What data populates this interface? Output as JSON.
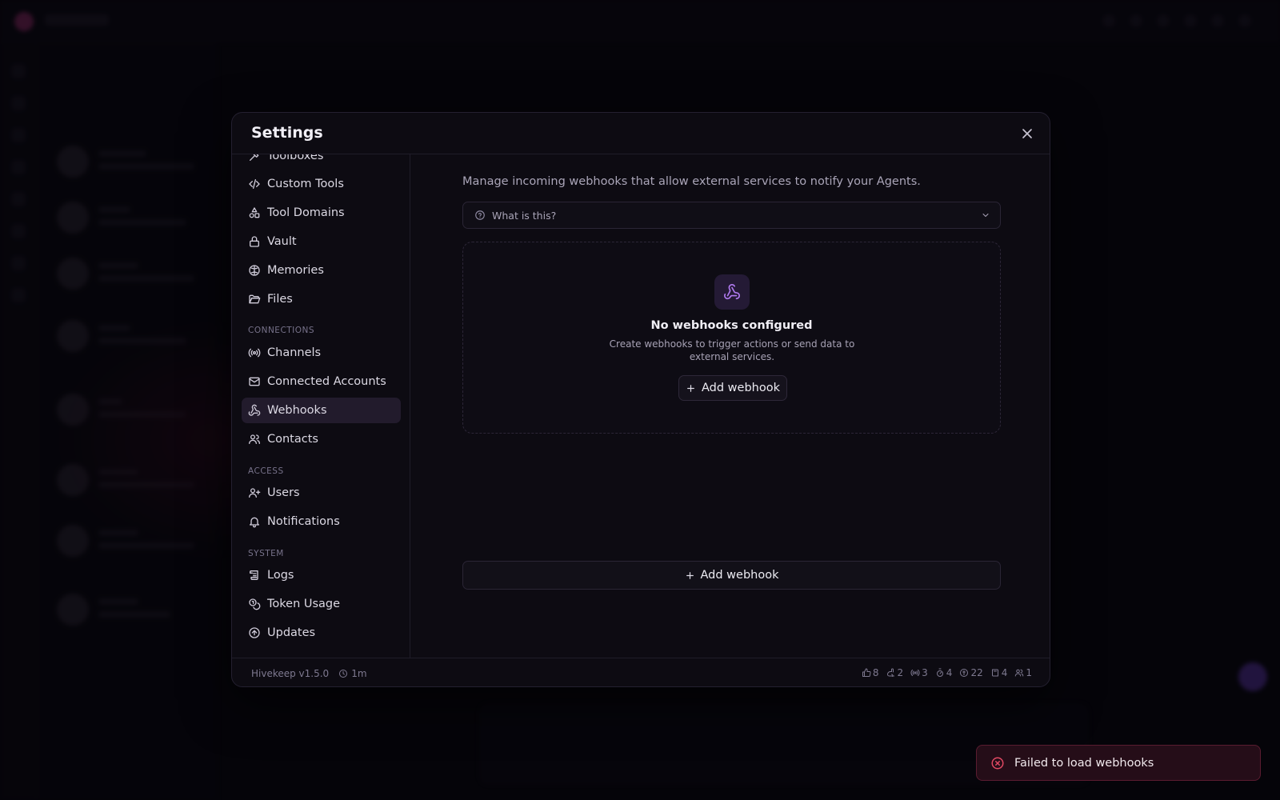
{
  "modal": {
    "title": "Settings"
  },
  "sidebar": {
    "items_top": [
      {
        "label": "Toolboxes",
        "icon": "toolbox-icon"
      },
      {
        "label": "Custom Tools",
        "icon": "code-icon"
      },
      {
        "label": "Tool Domains",
        "icon": "shapes-icon"
      },
      {
        "label": "Vault",
        "icon": "lock-icon"
      },
      {
        "label": "Memories",
        "icon": "brain-icon"
      },
      {
        "label": "Files",
        "icon": "folder-open-icon"
      }
    ],
    "sections": [
      {
        "label": "CONNECTIONS",
        "items": [
          {
            "label": "Channels",
            "icon": "radio-icon"
          },
          {
            "label": "Connected Accounts",
            "icon": "mail-icon"
          },
          {
            "label": "Webhooks",
            "icon": "webhook-icon",
            "active": true
          },
          {
            "label": "Contacts",
            "icon": "users-icon"
          }
        ]
      },
      {
        "label": "ACCESS",
        "items": [
          {
            "label": "Users",
            "icon": "user-plus-icon"
          },
          {
            "label": "Notifications",
            "icon": "bell-icon"
          }
        ]
      },
      {
        "label": "SYSTEM",
        "items": [
          {
            "label": "Logs",
            "icon": "scroll-icon"
          },
          {
            "label": "Token Usage",
            "icon": "coins-icon"
          },
          {
            "label": "Updates",
            "icon": "arrow-up-circle-icon"
          }
        ]
      }
    ]
  },
  "content": {
    "description": "Manage incoming webhooks that allow external services to notify your Agents.",
    "faq_label": "What is this?",
    "empty_title": "No webhooks configured",
    "empty_subtitle": "Create webhooks to trigger actions or send data to external services.",
    "add_webhook_small": "Add webhook",
    "add_webhook_wide": "Add webhook"
  },
  "footer": {
    "version": "Hivekeep v1.5.0",
    "uptime": "1m",
    "stats": [
      {
        "icon": "thumbs-up-icon",
        "value": "8"
      },
      {
        "icon": "rabbit-icon",
        "value": "2"
      },
      {
        "icon": "radio-icon",
        "value": "3"
      },
      {
        "icon": "timer-icon",
        "value": "4"
      },
      {
        "icon": "wrench-circle-icon",
        "value": "22"
      },
      {
        "icon": "book-icon",
        "value": "4"
      },
      {
        "icon": "users-icon",
        "value": "1"
      }
    ]
  },
  "toast": {
    "message": "Failed to load webhooks",
    "status_color": "#e04862"
  },
  "colors": {
    "accent": "#b07af0",
    "active_nav_bg": "#221b2c"
  }
}
